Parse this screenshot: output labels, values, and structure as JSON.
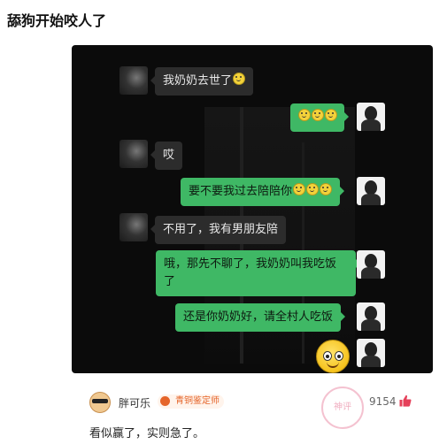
{
  "post": {
    "title": "舔狗开始咬人了"
  },
  "chat": {
    "messages": [
      {
        "side": "in",
        "text": "我奶奶去世了"
      },
      {
        "side": "out",
        "text": ""
      },
      {
        "side": "in",
        "text": "哎"
      },
      {
        "side": "out",
        "text": "要不要我过去陪陪你"
      },
      {
        "side": "in",
        "text": "不用了，我有男朋友陪"
      },
      {
        "side": "out",
        "text_line1": "哦，那先不聊了，我奶奶叫我吃饭",
        "text_line2": "了"
      },
      {
        "side": "out",
        "text": "还是你奶奶好，请全村人吃饭"
      }
    ]
  },
  "comment": {
    "username": "胖可乐",
    "badge": "青铜鉴定师",
    "stamp": "神评",
    "likes": "9154",
    "text": "看似赢了，实则急了。"
  },
  "colors": {
    "bubble_out": "#3fb865",
    "bubble_in": "#2c2c2c",
    "badge": "#e5652a",
    "like": "#e5405a"
  }
}
